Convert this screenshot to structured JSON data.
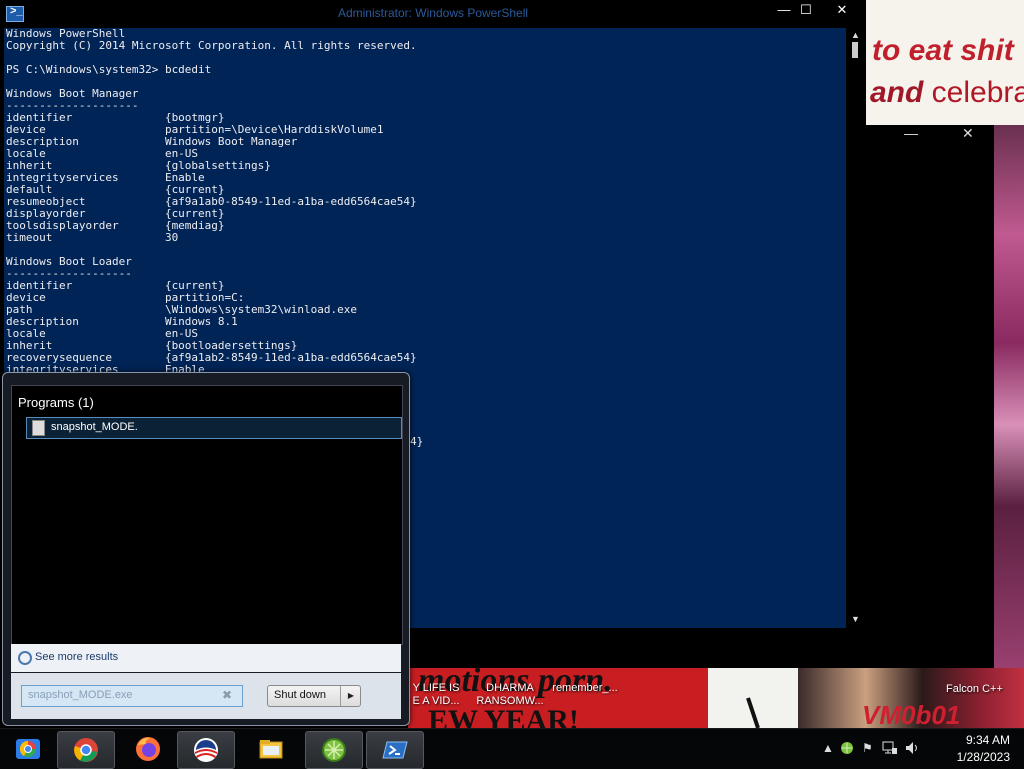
{
  "powershell": {
    "title": "Administrator: Windows PowerShell",
    "console_lines": [
      "Windows PowerShell",
      "Copyright (C) 2014 Microsoft Corporation. All rights reserved.",
      "",
      "PS C:\\Windows\\system32> bcdedit",
      "",
      "Windows Boot Manager",
      "--------------------",
      "identifier              {bootmgr}",
      "device                  partition=\\Device\\HarddiskVolume1",
      "description             Windows Boot Manager",
      "locale                  en-US",
      "inherit                 {globalsettings}",
      "integrityservices       Enable",
      "default                 {current}",
      "resumeobject            {af9a1ab0-8549-11ed-a1ba-edd6564cae54}",
      "displayorder            {current}",
      "toolsdisplayorder       {memdiag}",
      "timeout                 30",
      "",
      "Windows Boot Loader",
      "-------------------",
      "identifier              {current}",
      "device                  partition=C:",
      "path                    \\Windows\\system32\\winload.exe",
      "description             Windows 8.1",
      "locale                  en-US",
      "inherit                 {bootloadersettings}",
      "recoverysequence        {af9a1ab2-8549-11ed-a1ba-edd6564cae54}",
      "integrityservices       Enable",
      "",
      "",
      "",
      "",
      "",
      "                                                          ae54}"
    ]
  },
  "start_menu": {
    "programs_header": "Programs (1)",
    "result_item": "snapshot_MODE.",
    "see_more": "See more results",
    "search_value": "snapshot_MODE.exe",
    "shutdown_label": "Shut down"
  },
  "desktop": {
    "sign_line1": "to eat shit",
    "sign_line2_bold": "and",
    "sign_line2_rest": " celebra",
    "banner_text": "motions porn.",
    "banner_text2": "EW YEAR!",
    "vm_text": "VM0b01",
    "icons": [
      {
        "line1": "Y LIFE IS",
        "line2": "E A VID..."
      },
      {
        "line1": "DHARMA",
        "line2": "RANSOMW..."
      },
      {
        "line1": "remember_...",
        "line2": ""
      }
    ],
    "falcon_label": "Falcon C++"
  },
  "taskbar": {
    "time": "9:34 AM",
    "date": "1/28/2023",
    "buttons": [
      "chrome-remote-icon",
      "chrome-icon",
      "firefox-icon",
      "obama-logo-icon",
      "file-explorer-icon",
      "green-app-icon",
      "powershell-icon"
    ]
  },
  "colors": {
    "console_bg": "#012456",
    "console_fg": "#eeedf0",
    "taskbar_bg": "#050607"
  }
}
